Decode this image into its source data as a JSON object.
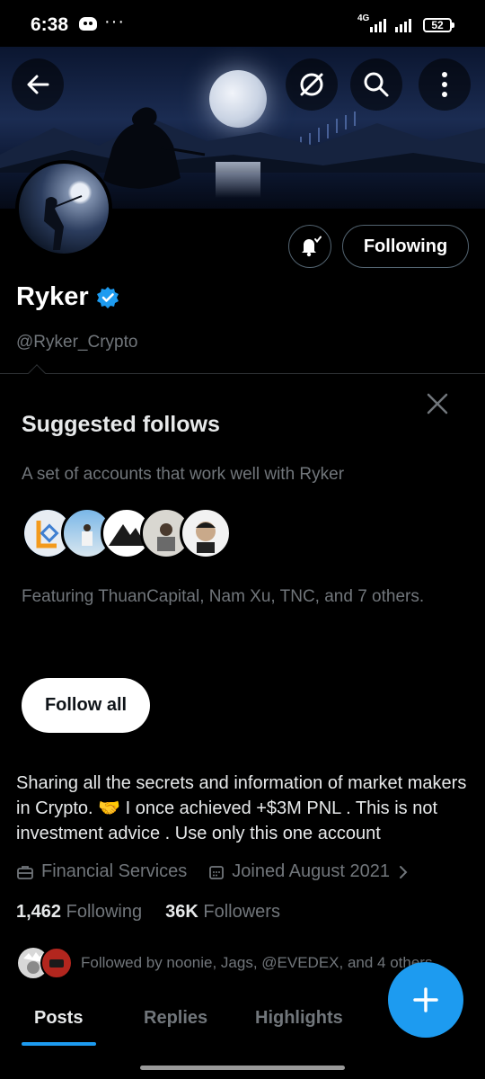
{
  "status_bar": {
    "time": "6:38",
    "network": "4G",
    "battery": "52"
  },
  "profile": {
    "display_name": "Ryker",
    "handle": "@Ryker_Crypto",
    "following_button": "Following",
    "verified_color": "#1d9bf0"
  },
  "suggested": {
    "title": "Suggested follows",
    "subtitle": "A set of accounts that work well with Ryker",
    "featuring": "Featuring ThuanCapital, Nam Xu, TNC, and 7 others.",
    "follow_all": "Follow all"
  },
  "bio": "Sharing all the secrets and information of market makers in Crypto. 🤝 I once achieved +$3M PNL . This is not investment advice . Use only this one account",
  "meta": {
    "category": "Financial Services",
    "joined": "Joined August 2021"
  },
  "stats": {
    "following_count": "1,462",
    "following_label": "Following",
    "followers_count": "36K",
    "followers_label": "Followers"
  },
  "followed_by": "Followed by noonie, Jags, @EVEDEX, and 4 others",
  "tabs": [
    {
      "label": "Posts"
    },
    {
      "label": "Replies"
    },
    {
      "label": "Highlights"
    }
  ],
  "icons": [
    "back-arrow-icon",
    "grok-icon",
    "search-icon",
    "more-vertical-icon",
    "bell-check-icon",
    "verified-badge-icon",
    "close-icon",
    "briefcase-icon",
    "calendar-icon",
    "chevron-right-icon",
    "plus-icon"
  ],
  "accent_color": "#1d9bf0"
}
